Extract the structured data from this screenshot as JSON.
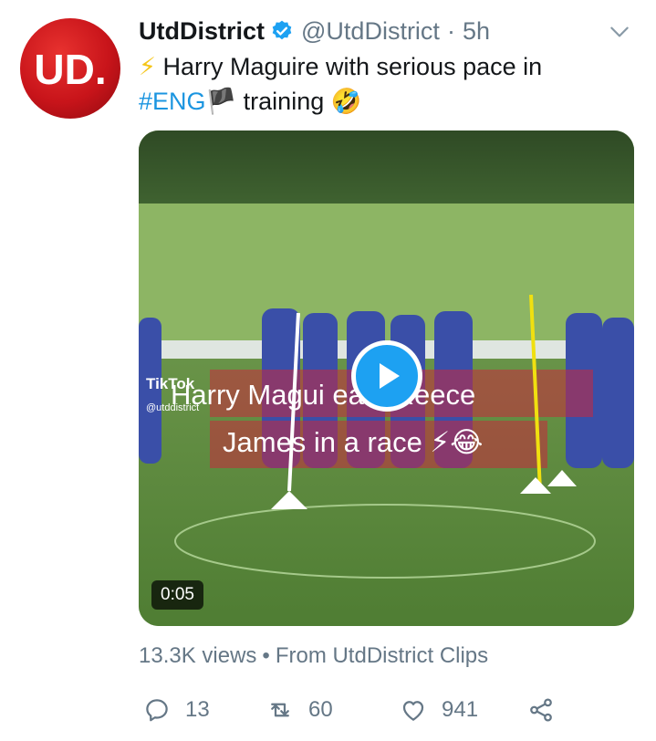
{
  "tweet": {
    "author": {
      "display_name": "UtdDistrict",
      "handle": "@UtdDistrict",
      "verified": true,
      "avatar_text": "UD."
    },
    "separator": "·",
    "time": "5h",
    "text": {
      "line1_emoji": "⚡",
      "line1": "Harry Maguire with serious pace in",
      "hashtag": "#ENG",
      "flag_emoji": "🏴",
      "line2_rest": "training",
      "laugh_emoji": "🤣"
    },
    "media": {
      "caption_line1": "Harry Magui    eats Reece",
      "caption_line2": "James in a race ⚡😂",
      "watermark": "TikTok",
      "watermark_handle": "@utddistrict",
      "duration": "0:05"
    },
    "meta": {
      "views": "13.3K views",
      "separator": "•",
      "source": "From UtdDistrict Clips"
    },
    "actions": {
      "replies": "13",
      "retweets": "60",
      "likes": "941"
    }
  },
  "icons": [
    "verified-badge-icon",
    "chevron-down-icon",
    "reply-icon",
    "retweet-icon",
    "like-icon",
    "share-icon",
    "play-icon",
    "tiktok-icon"
  ],
  "colors": {
    "text": "#14171a",
    "secondary": "#657786",
    "link": "#1b95e0",
    "accent": "#1da1f2",
    "avatar_red": "#c8141a"
  }
}
